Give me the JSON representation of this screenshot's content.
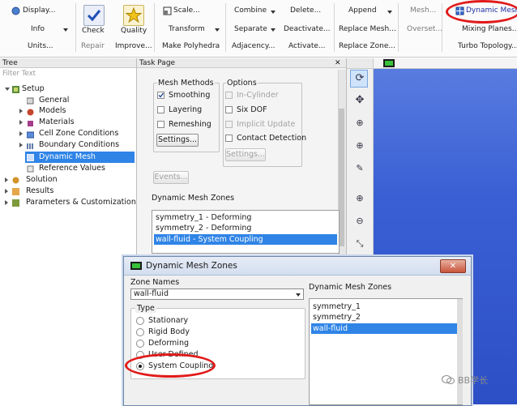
{
  "ribbon": {
    "display_label": "Display...",
    "info_label": "Info",
    "units_label": "Units...",
    "check_label": "Check",
    "repair_label": "Repair",
    "quality_label": "Quality",
    "improve_label": "Improve...",
    "scale_label": "Scale...",
    "transform_label": "Transform",
    "make_polyhedra_label": "Make Polyhedra",
    "combine_label": "Combine",
    "separate_label": "Separate",
    "adjacency_label": "Adjacency...",
    "delete_label": "Delete...",
    "deactivate_label": "Deactivate...",
    "activate_label": "Activate...",
    "append_label": "Append",
    "replace_mesh_label": "Replace Mesh...",
    "replace_zone_label": "Replace Zone...",
    "mesh_label": "Mesh...",
    "overset_label": "Overset...",
    "dynamic_mesh_label": "Dynamic Mesh",
    "mixing_planes_label": "Mixing Planes...",
    "turbo_topology_label": "Turbo Topology..."
  },
  "tree": {
    "header": "Tree",
    "filter_placeholder": "Filter Text",
    "items": [
      {
        "label": "Setup",
        "icon": "setup-icon"
      },
      {
        "label": "General",
        "icon": "general-icon"
      },
      {
        "label": "Models",
        "icon": "models-icon"
      },
      {
        "label": "Materials",
        "icon": "materials-icon"
      },
      {
        "label": "Cell Zone Conditions",
        "icon": "cell-zone-icon"
      },
      {
        "label": "Boundary Conditions",
        "icon": "boundary-icon"
      },
      {
        "label": "Dynamic Mesh",
        "icon": "dynamic-mesh-icon"
      },
      {
        "label": "Reference Values",
        "icon": "reference-icon"
      },
      {
        "label": "Solution",
        "icon": "solution-icon"
      },
      {
        "label": "Results",
        "icon": "results-icon"
      },
      {
        "label": "Parameters & Customization",
        "icon": "parameters-icon"
      }
    ]
  },
  "task": {
    "header": "Task Page",
    "mesh_methods_title": "Mesh Methods",
    "smoothing": "Smoothing",
    "layering": "Layering",
    "remeshing": "Remeshing",
    "settings_label": "Settings...",
    "options_title": "Options",
    "in_cylinder": "In-Cylinder",
    "six_dof": "Six DOF",
    "implicit_update": "Implicit Update",
    "contact_detection": "Contact Detection",
    "options_settings_label": "Settings...",
    "events_label": "Events...",
    "zones_title": "Dynamic Mesh Zones",
    "zones": [
      "symmetry_1 - Deforming",
      "symmetry_2 - Deforming",
      "wall-fluid - System Coupling"
    ]
  },
  "dialog": {
    "title": "Dynamic Mesh Zones",
    "close_label": "✕",
    "zone_names_label": "Zone Names",
    "zone_value": "wall-fluid",
    "type_title": "Type",
    "types": [
      "Stationary",
      "Rigid Body",
      "Deforming",
      "User-Defined",
      "System Coupling"
    ],
    "zones_title": "Dynamic Mesh Zones",
    "zones": [
      "symmetry_1",
      "symmetry_2",
      "wall-fluid"
    ]
  },
  "watermark": "BB学长",
  "colors": {
    "selection": "#2f84e6",
    "highlight_ring": "#e11a1a",
    "viewer_bg": "#3a5fd4"
  }
}
